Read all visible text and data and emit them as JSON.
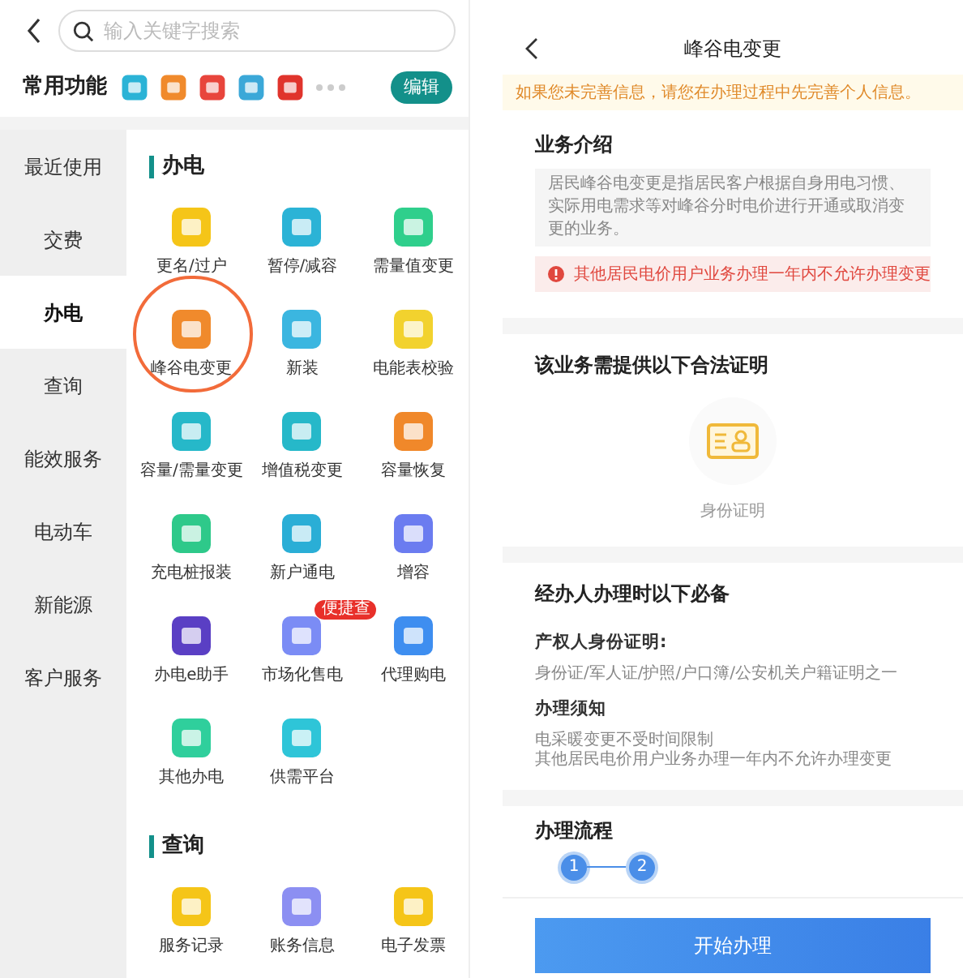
{
  "left": {
    "search": {
      "placeholder": "输入关键字搜索"
    },
    "favorites": {
      "title": "常用功能",
      "edit_button": "编辑"
    },
    "sidebar": [
      {
        "label": "最近使用",
        "selected": false
      },
      {
        "label": "交费",
        "selected": false
      },
      {
        "label": "办电",
        "selected": true
      },
      {
        "label": "查询",
        "selected": false
      },
      {
        "label": "能效服务",
        "selected": false
      },
      {
        "label": "电动车",
        "selected": false
      },
      {
        "label": "新能源",
        "selected": false
      },
      {
        "label": "客户服务",
        "selected": false
      }
    ],
    "sections": [
      {
        "title": "办电",
        "items": [
          {
            "label": "更名/过户",
            "highlighted": false
          },
          {
            "label": "暂停/减容",
            "highlighted": false
          },
          {
            "label": "需量值变更",
            "highlighted": false
          },
          {
            "label": "峰谷电变更",
            "highlighted": true
          },
          {
            "label": "新装",
            "highlighted": false
          },
          {
            "label": "电能表校验",
            "highlighted": false
          },
          {
            "label": "容量/需量变更",
            "highlighted": false
          },
          {
            "label": "增值税变更",
            "highlighted": false
          },
          {
            "label": "容量恢复",
            "highlighted": false
          },
          {
            "label": "充电桩报装",
            "highlighted": false
          },
          {
            "label": "新户通电",
            "highlighted": false
          },
          {
            "label": "增容",
            "highlighted": false
          },
          {
            "label": "办电e助手",
            "highlighted": false
          },
          {
            "label": "市场化售电",
            "badge": "便捷查",
            "highlighted": false
          },
          {
            "label": "代理购电",
            "highlighted": false
          },
          {
            "label": "其他办电",
            "highlighted": false
          },
          {
            "label": "供需平台",
            "highlighted": false
          }
        ]
      },
      {
        "title": "查询",
        "items": [
          {
            "label": "服务记录",
            "highlighted": false
          },
          {
            "label": "账务信息",
            "highlighted": false
          },
          {
            "label": "电子发票",
            "highlighted": false
          }
        ]
      }
    ]
  },
  "right": {
    "title": "峰谷电变更",
    "notice": "如果您未完善信息，请您在办理过程中先完善个人信息。",
    "intro": {
      "heading": "业务介绍",
      "text": "居民峰谷电变更是指居民客户根据自身用电习惯、实际用电需求等对峰谷分时电价进行开通或取消变更的业务。",
      "warning": "其他居民电价用户业务办理一年内不允许办理变更"
    },
    "proofs": {
      "heading": "该业务需提供以下合法证明",
      "items": [
        {
          "label": "身份证明"
        }
      ]
    },
    "requirements": {
      "heading": "经办人办理时以下必备",
      "groups": [
        {
          "title": "产权人身份证明:",
          "lines": [
            "身份证/军人证/护照/户口簿/公安机关户籍证明之一"
          ]
        },
        {
          "title": "办理须知",
          "lines": [
            "电采暖变更不受时间限制",
            "其他居民电价用户业务办理一年内不允许办理变更"
          ]
        }
      ]
    },
    "process": {
      "heading": "办理流程",
      "steps": [
        "1",
        "2"
      ]
    },
    "start_button": "开始办理"
  }
}
